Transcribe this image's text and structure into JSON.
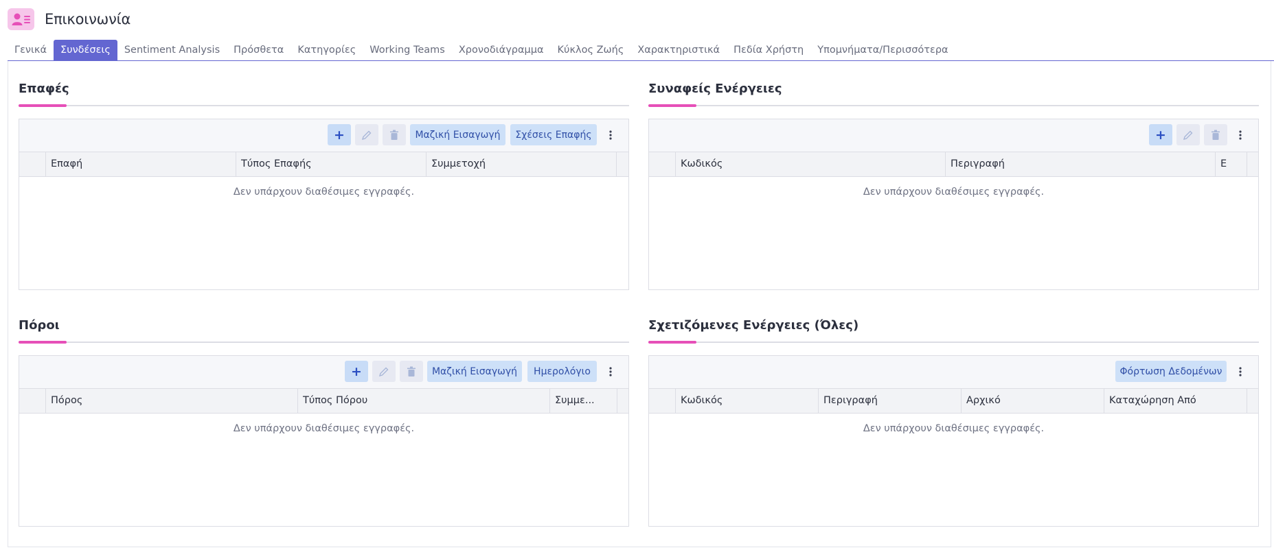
{
  "app": {
    "title": "Επικοινωνία",
    "icon": "contact-card-icon",
    "accent": "#e64fb8"
  },
  "tabs": [
    {
      "label": "Γενικά"
    },
    {
      "label": "Συνδέσεις",
      "active": true
    },
    {
      "label": "Sentiment Analysis"
    },
    {
      "label": "Πρόσθετα"
    },
    {
      "label": "Κατηγορίες"
    },
    {
      "label": "Working Teams"
    },
    {
      "label": "Χρονοδιάγραμμα"
    },
    {
      "label": "Κύκλος Ζωής"
    },
    {
      "label": "Χαρακτηριστικά"
    },
    {
      "label": "Πεδία Χρήστη"
    },
    {
      "label": "Υπομνήματα/Περισσότερα"
    }
  ],
  "colors": {
    "tab_active": "#6366d1",
    "section_accent": "#e64fb8",
    "button_bg": "#cde0f8",
    "button_text": "#2f4ea6"
  },
  "sections": {
    "contacts": {
      "title": "Επαφές",
      "buttons": {
        "mass_import": "Μαζική Εισαγωγή",
        "contact_relations": "Σχέσεις Επαφής"
      },
      "columns": [
        "Επαφή",
        "Τύπος Επαφής",
        "Συμμετοχή"
      ],
      "empty": "Δεν υπάρχουν διαθέσιμες εγγραφές."
    },
    "related_actions": {
      "title": "Συναφείς Ενέργειες",
      "columns": [
        "Κωδικός",
        "Περιγραφή",
        "Ε"
      ],
      "empty": "Δεν υπάρχουν διαθέσιμες εγγραφές."
    },
    "resources": {
      "title": "Πόροι",
      "buttons": {
        "mass_import": "Μαζική Εισαγωγή",
        "calendar": "Ημερολόγιο"
      },
      "columns": [
        "Πόρος",
        "Τύπος Πόρου",
        "Συμμε..."
      ],
      "empty": "Δεν υπάρχουν διαθέσιμες εγγραφές."
    },
    "all_related_actions": {
      "title": "Σχετιζόμενες Ενέργειες (Όλες)",
      "buttons": {
        "load_data": "Φόρτωση Δεδομένων"
      },
      "columns": [
        "Κωδικός",
        "Περιγραφή",
        "Αρχικό",
        "Καταχώρηση Από"
      ],
      "empty": "Δεν υπάρχουν διαθέσιμες εγγραφές."
    }
  }
}
